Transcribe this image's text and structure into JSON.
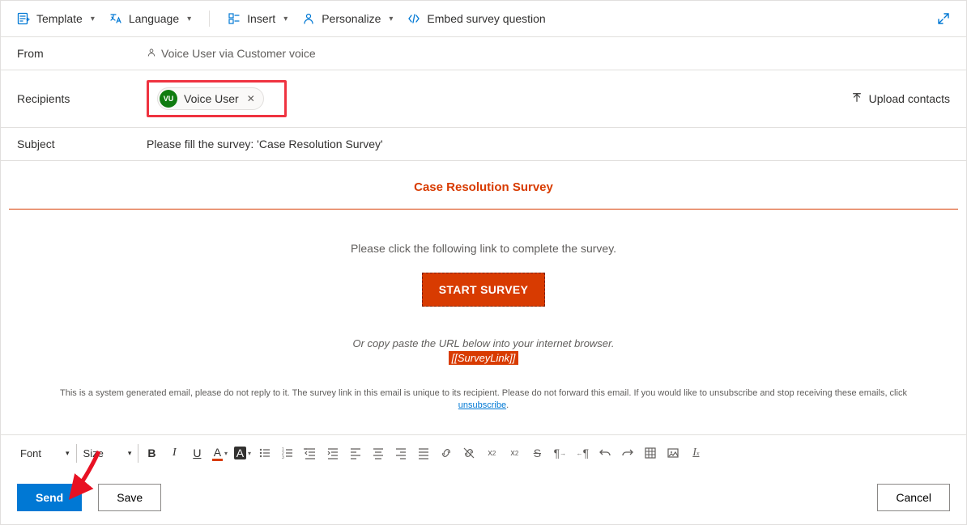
{
  "toolbar": {
    "template": "Template",
    "language": "Language",
    "insert": "Insert",
    "personalize": "Personalize",
    "embed": "Embed survey question"
  },
  "fields": {
    "from_label": "From",
    "from_value": "Voice User via Customer voice",
    "recipients_label": "Recipients",
    "recipient_chip": {
      "initials": "VU",
      "name": "Voice User"
    },
    "upload_contacts": "Upload contacts",
    "subject_label": "Subject",
    "subject_value": "Please fill the survey: 'Case Resolution Survey'"
  },
  "body": {
    "survey_title": "Case Resolution Survey",
    "instruction": "Please click the following link to complete the survey.",
    "start_button": "START SURVEY",
    "copy_hint": "Or copy paste the URL below into your internet browser.",
    "survey_link_token": "[[SurveyLink]]",
    "disclaimer_pre": "This is a system generated email, please do not reply to it. The survey link in this email is unique to its recipient. Please do not forward this email. If you would like to unsubscribe and stop receiving these emails, click ",
    "unsubscribe": "unsubscribe",
    "disclaimer_post": "."
  },
  "editor": {
    "font_label": "Font",
    "size_label": "Size"
  },
  "buttons": {
    "send": "Send",
    "save": "Save",
    "cancel": "Cancel"
  }
}
